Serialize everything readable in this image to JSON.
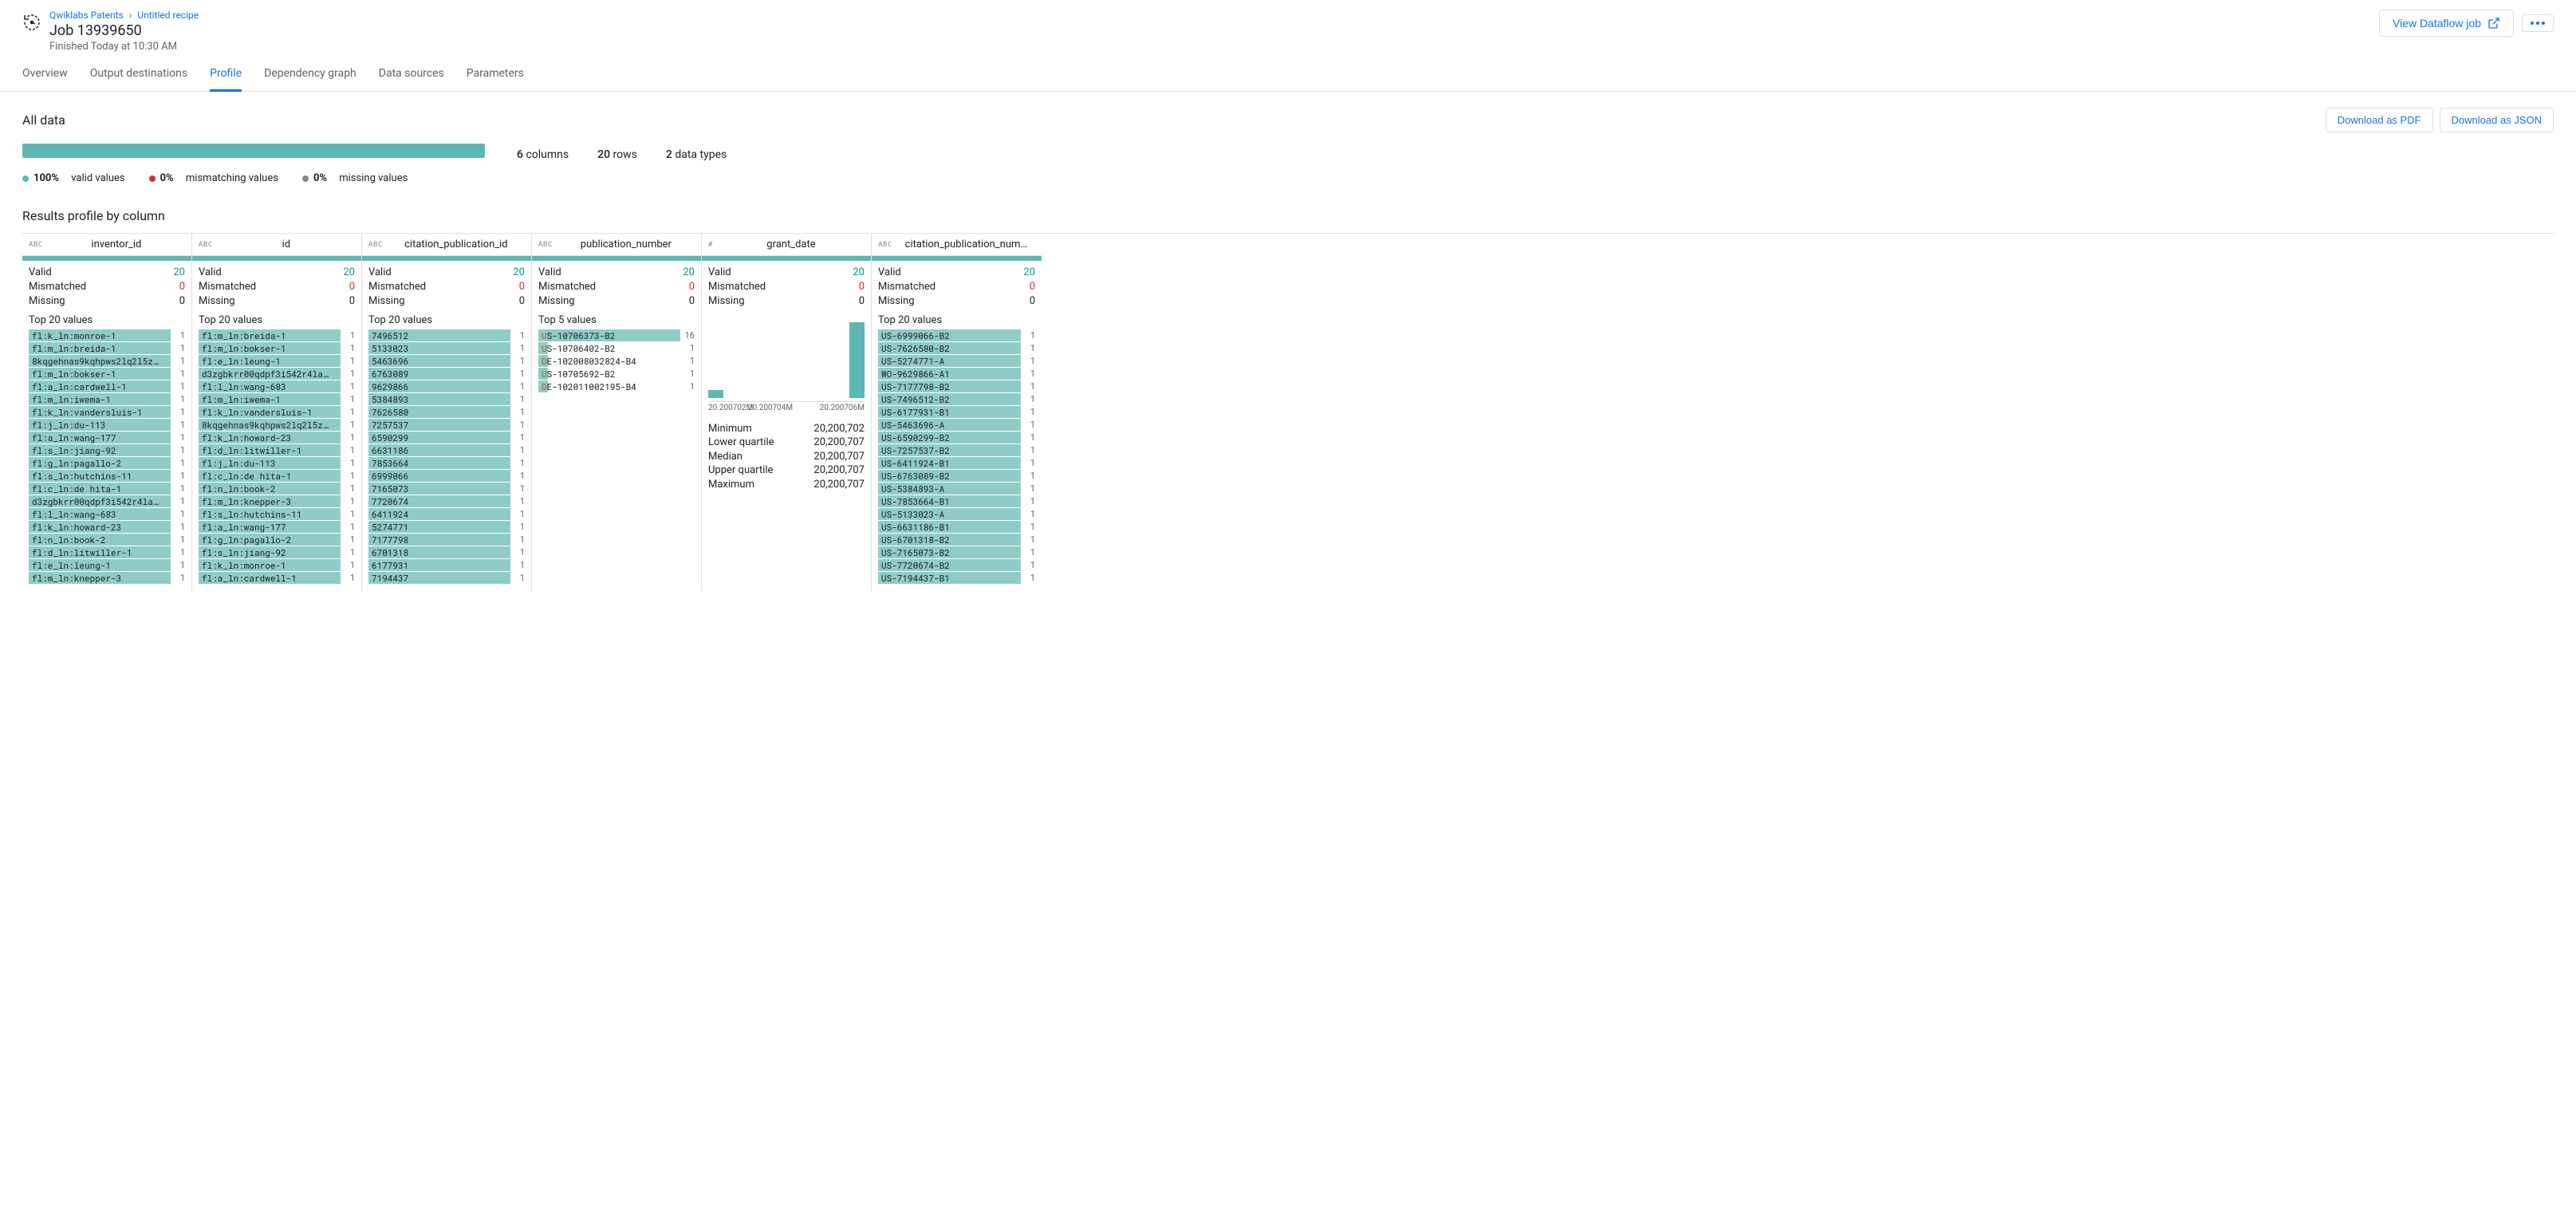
{
  "breadcrumb": {
    "project": "Qwiklabs Patents",
    "recipe": "Untitled recipe"
  },
  "job": {
    "title": "Job 13939650",
    "subtitle": "Finished Today at 10:30 AM"
  },
  "header_actions": {
    "dataflow": "View Dataflow job"
  },
  "tabs": [
    "Overview",
    "Output destinations",
    "Profile",
    "Dependency graph",
    "Data sources",
    "Parameters"
  ],
  "active_tab": "Profile",
  "section": {
    "title": "All data",
    "download_pdf": "Download as PDF",
    "download_json": "Download as JSON"
  },
  "summary": {
    "columns_n": "6",
    "columns_lbl": "columns",
    "rows_n": "20",
    "rows_lbl": "rows",
    "types_n": "2",
    "types_lbl": "data types"
  },
  "legend": {
    "valid_pct": "100%",
    "valid_lbl": "valid values",
    "mismatch_pct": "0%",
    "mismatch_lbl": "mismatching values",
    "missing_pct": "0%",
    "missing_lbl": "missing values"
  },
  "results_title": "Results profile by column",
  "stat_labels": {
    "valid": "Valid",
    "mismatched": "Mismatched",
    "missing": "Missing"
  },
  "columns": [
    {
      "type": "ABC",
      "name": "inventor_id",
      "valid": "20",
      "mismatched": "0",
      "missing": "0",
      "top_label": "Top 20 values",
      "values": [
        {
          "t": "fl:k_ln:monroe-1",
          "c": "1",
          "w": 100
        },
        {
          "t": "fl:m_ln:breida-1",
          "c": "1",
          "w": 100
        },
        {
          "t": "8kqgehnas9kqhpws2lq2l5z…",
          "c": "1",
          "w": 100
        },
        {
          "t": "fl:m_ln:bokser-1",
          "c": "1",
          "w": 100
        },
        {
          "t": "fl:a_ln:cardwell-1",
          "c": "1",
          "w": 100
        },
        {
          "t": "fl:m_ln:iwema-1",
          "c": "1",
          "w": 100
        },
        {
          "t": "fl:k_ln:vandersluis-1",
          "c": "1",
          "w": 100
        },
        {
          "t": "fl:j_ln:du-113",
          "c": "1",
          "w": 100
        },
        {
          "t": "fl:a_ln:wang-177",
          "c": "1",
          "w": 100
        },
        {
          "t": "fl:s_ln:jiang-92",
          "c": "1",
          "w": 100
        },
        {
          "t": "fl:g_ln:pagallo-2",
          "c": "1",
          "w": 100
        },
        {
          "t": "fl:s_ln:hutchins-11",
          "c": "1",
          "w": 100
        },
        {
          "t": "fl:c_ln:de hita-1",
          "c": "1",
          "w": 100
        },
        {
          "t": "d3zgbkrr00qdpf3i542r4la…",
          "c": "1",
          "w": 100
        },
        {
          "t": "fl:l_ln:wang-683",
          "c": "1",
          "w": 100
        },
        {
          "t": "fl:k_ln:howard-23",
          "c": "1",
          "w": 100
        },
        {
          "t": "fl:n_ln:book-2",
          "c": "1",
          "w": 100
        },
        {
          "t": "fl:d_ln:litwiller-1",
          "c": "1",
          "w": 100
        },
        {
          "t": "fl:e_ln:leung-1",
          "c": "1",
          "w": 100
        },
        {
          "t": "fl:m_ln:knepper-3",
          "c": "1",
          "w": 100
        }
      ]
    },
    {
      "type": "ABC",
      "name": "id",
      "valid": "20",
      "mismatched": "0",
      "missing": "0",
      "top_label": "Top 20 values",
      "values": [
        {
          "t": "fl:m_ln:breida-1",
          "c": "1",
          "w": 100
        },
        {
          "t": "fl:m_ln:bokser-1",
          "c": "1",
          "w": 100
        },
        {
          "t": "fl:e_ln:leung-1",
          "c": "1",
          "w": 100
        },
        {
          "t": "d3zgbkrr00qdpf3i542r4la…",
          "c": "1",
          "w": 100
        },
        {
          "t": "fl:l_ln:wang-683",
          "c": "1",
          "w": 100
        },
        {
          "t": "fl:m_ln:iwema-1",
          "c": "1",
          "w": 100
        },
        {
          "t": "fl:k_ln:vandersluis-1",
          "c": "1",
          "w": 100
        },
        {
          "t": "8kqgehnas9kqhpws2lq2l5z…",
          "c": "1",
          "w": 100
        },
        {
          "t": "fl:k_ln:howard-23",
          "c": "1",
          "w": 100
        },
        {
          "t": "fl:d_ln:litwiller-1",
          "c": "1",
          "w": 100
        },
        {
          "t": "fl:j_ln:du-113",
          "c": "1",
          "w": 100
        },
        {
          "t": "fl:c_ln:de hita-1",
          "c": "1",
          "w": 100
        },
        {
          "t": "fl:n_ln:book-2",
          "c": "1",
          "w": 100
        },
        {
          "t": "fl:m_ln:knepper-3",
          "c": "1",
          "w": 100
        },
        {
          "t": "fl:s_ln:hutchins-11",
          "c": "1",
          "w": 100
        },
        {
          "t": "fl:a_ln:wang-177",
          "c": "1",
          "w": 100
        },
        {
          "t": "fl:g_ln:pagallo-2",
          "c": "1",
          "w": 100
        },
        {
          "t": "fl:s_ln:jiang-92",
          "c": "1",
          "w": 100
        },
        {
          "t": "fl:k_ln:monroe-1",
          "c": "1",
          "w": 100
        },
        {
          "t": "fl:a_ln:cardwell-1",
          "c": "1",
          "w": 100
        }
      ]
    },
    {
      "type": "ABC",
      "name": "citation_publication_id",
      "valid": "20",
      "mismatched": "0",
      "missing": "0",
      "top_label": "Top 20 values",
      "values": [
        {
          "t": "7496512",
          "c": "1",
          "w": 100
        },
        {
          "t": "5133023",
          "c": "1",
          "w": 100
        },
        {
          "t": "5463696",
          "c": "1",
          "w": 100
        },
        {
          "t": "6763089",
          "c": "1",
          "w": 100
        },
        {
          "t": "9629866",
          "c": "1",
          "w": 100
        },
        {
          "t": "5384893",
          "c": "1",
          "w": 100
        },
        {
          "t": "7626580",
          "c": "1",
          "w": 100
        },
        {
          "t": "7257537",
          "c": "1",
          "w": 100
        },
        {
          "t": "6590299",
          "c": "1",
          "w": 100
        },
        {
          "t": "6631186",
          "c": "1",
          "w": 100
        },
        {
          "t": "7853664",
          "c": "1",
          "w": 100
        },
        {
          "t": "6999066",
          "c": "1",
          "w": 100
        },
        {
          "t": "7165073",
          "c": "1",
          "w": 100
        },
        {
          "t": "7720674",
          "c": "1",
          "w": 100
        },
        {
          "t": "6411924",
          "c": "1",
          "w": 100
        },
        {
          "t": "5274771",
          "c": "1",
          "w": 100
        },
        {
          "t": "7177798",
          "c": "1",
          "w": 100
        },
        {
          "t": "6701318",
          "c": "1",
          "w": 100
        },
        {
          "t": "6177931",
          "c": "1",
          "w": 100
        },
        {
          "t": "7194437",
          "c": "1",
          "w": 100
        }
      ]
    },
    {
      "type": "ABC",
      "name": "publication_number",
      "valid": "20",
      "mismatched": "0",
      "missing": "0",
      "top_label": "Top 5 values",
      "values": [
        {
          "t": "US-10706373-B2",
          "c": "16",
          "w": 100,
          "hl": 1
        },
        {
          "t": "US-10706402-B2",
          "c": "1",
          "w": 7,
          "hl": 1
        },
        {
          "t": "DE-102008032824-B4",
          "c": "1",
          "w": 7,
          "hl": 1
        },
        {
          "t": "US-10705692-B2",
          "c": "1",
          "w": 7,
          "hl": 1
        },
        {
          "t": "DE-102011002195-B4",
          "c": "1",
          "w": 7,
          "hl": 1
        }
      ]
    },
    {
      "type": "#",
      "name": "grant_date",
      "valid": "20",
      "mismatched": "0",
      "missing": "0",
      "numeric": true,
      "histogram": {
        "bars": [
          10,
          0,
          0,
          0,
          0,
          0,
          0,
          0,
          0,
          100
        ],
        "min_label": "20.200702M",
        "mid_label": "20.200704M",
        "max_label": "20.200706M"
      },
      "num_stats": [
        {
          "l": "Minimum",
          "v": "20,200,702"
        },
        {
          "l": "Lower quartile",
          "v": "20,200,707"
        },
        {
          "l": "Median",
          "v": "20,200,707"
        },
        {
          "l": "Upper quartile",
          "v": "20,200,707"
        },
        {
          "l": "Maximum",
          "v": "20,200,707"
        }
      ]
    },
    {
      "type": "ABC",
      "name": "citation_publication_num…",
      "valid": "20",
      "mismatched": "0",
      "missing": "0",
      "top_label": "Top 20 values",
      "values": [
        {
          "t": "US-6999066-B2",
          "c": "1",
          "w": 100
        },
        {
          "t": "US-7626580-B2",
          "c": "1",
          "w": 100
        },
        {
          "t": "US-5274771-A",
          "c": "1",
          "w": 100
        },
        {
          "t": "WO-9629866-A1",
          "c": "1",
          "w": 100
        },
        {
          "t": "US-7177798-B2",
          "c": "1",
          "w": 100
        },
        {
          "t": "US-7496512-B2",
          "c": "1",
          "w": 100
        },
        {
          "t": "US-6177931-B1",
          "c": "1",
          "w": 100
        },
        {
          "t": "US-5463696-A",
          "c": "1",
          "w": 100
        },
        {
          "t": "US-6590299-B2",
          "c": "1",
          "w": 100
        },
        {
          "t": "US-7257537-B2",
          "c": "1",
          "w": 100
        },
        {
          "t": "US-6411924-B1",
          "c": "1",
          "w": 100
        },
        {
          "t": "US-6763089-B2",
          "c": "1",
          "w": 100
        },
        {
          "t": "US-5384893-A",
          "c": "1",
          "w": 100
        },
        {
          "t": "US-7853664-B1",
          "c": "1",
          "w": 100
        },
        {
          "t": "US-5133023-A",
          "c": "1",
          "w": 100
        },
        {
          "t": "US-6631186-B1",
          "c": "1",
          "w": 100
        },
        {
          "t": "US-6701318-B2",
          "c": "1",
          "w": 100
        },
        {
          "t": "US-7165073-B2",
          "c": "1",
          "w": 100
        },
        {
          "t": "US-7720674-B2",
          "c": "1",
          "w": 100
        },
        {
          "t": "US-7194437-B1",
          "c": "1",
          "w": 100
        }
      ]
    }
  ]
}
